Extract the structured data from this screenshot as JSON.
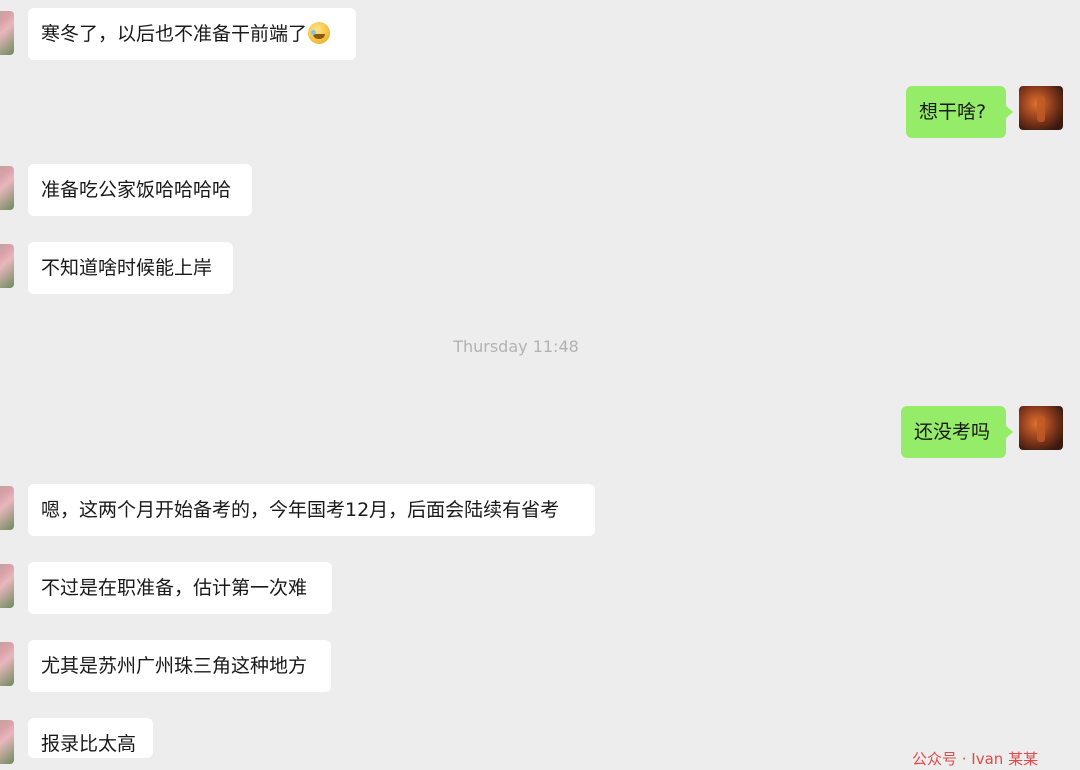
{
  "chat": {
    "timestamp": "Thursday 11:48",
    "messages": [
      {
        "side": "left",
        "text": "寒冬了，以后也不准备干前端了",
        "emoji": "face-with-tears-of-joy-icon"
      },
      {
        "side": "right",
        "text": "想干啥?"
      },
      {
        "side": "left",
        "text": "准备吃公家饭哈哈哈哈"
      },
      {
        "side": "left",
        "text": "不知道啥时候能上岸"
      },
      {
        "side": "right",
        "text": "还没考吗"
      },
      {
        "side": "left",
        "text": "嗯，这两个月开始备考的，今年国考12月，后面会陆续有省考"
      },
      {
        "side": "left",
        "text": "不过是在职准备，估计第一次难"
      },
      {
        "side": "left",
        "text": "尤其是苏州广州珠三角这种地方"
      },
      {
        "side": "left",
        "text": "报录比太高"
      }
    ]
  },
  "watermark": {
    "text": "公众号 · Ivan 某某"
  },
  "colors": {
    "background": "#ededed",
    "bubble_left": "#ffffff",
    "bubble_right": "#95ec69",
    "timestamp": "#b2b2b2",
    "watermark": "#e24a4a"
  }
}
